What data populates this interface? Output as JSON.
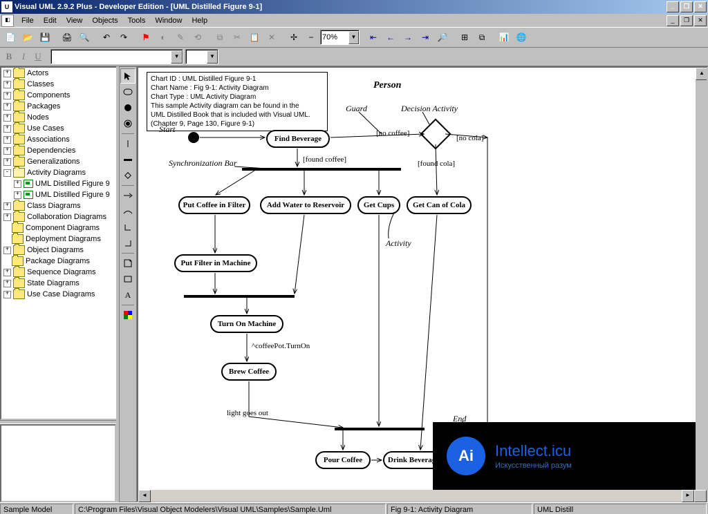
{
  "title": "Visual UML 2.9.2 Plus - Developer Edition - [UML Distilled Figure 9-1]",
  "menus": [
    "File",
    "Edit",
    "View",
    "Objects",
    "Tools",
    "Window",
    "Help"
  ],
  "zoom": "70%",
  "tree": {
    "root": [
      {
        "pm": "+",
        "label": "Actors"
      },
      {
        "pm": "+",
        "label": "Classes"
      },
      {
        "pm": "+",
        "label": "Components"
      },
      {
        "pm": "+",
        "label": "Packages"
      },
      {
        "pm": "+",
        "label": "Nodes"
      },
      {
        "pm": "+",
        "label": "Use Cases"
      },
      {
        "pm": "+",
        "label": "Associations"
      },
      {
        "pm": "+",
        "label": "Dependencies"
      },
      {
        "pm": "+",
        "label": "Generalizations"
      },
      {
        "pm": "-",
        "label": "Activity Diagrams",
        "open": true,
        "children": [
          {
            "label": "UML Distilled Figure 9"
          },
          {
            "label": "UML Distilled Figure 9"
          }
        ]
      },
      {
        "pm": "+",
        "label": "Class Diagrams"
      },
      {
        "pm": "+",
        "label": "Collaboration Diagrams"
      },
      {
        "pm": " ",
        "label": "Component Diagrams"
      },
      {
        "pm": " ",
        "label": "Deployment Diagrams"
      },
      {
        "pm": "+",
        "label": "Object Diagrams"
      },
      {
        "pm": " ",
        "label": "Package Diagrams"
      },
      {
        "pm": "+",
        "label": "Sequence Diagrams"
      },
      {
        "pm": "+",
        "label": "State Diagrams"
      },
      {
        "pm": "+",
        "label": "Use Case Diagrams"
      }
    ]
  },
  "note": {
    "l1": "Chart ID : UML Distilled Figure 9-1",
    "l2": "Chart Name : Fig 9-1: Activity Diagram",
    "l3": "Chart Type : UML Activity Diagram",
    "l4": "This sample Activity diagram can be found in the",
    "l5": "UML Distilled Book that is included with Visual UML.",
    "l6": "(Chapter 9, Page 130, Figure 9-1)"
  },
  "swimlane": "Person",
  "labels": {
    "start": "Start",
    "guard": "Guard",
    "decision": "Decision Activity",
    "syncbar": "Synchronization Bar",
    "activity": "Activity",
    "end": "End"
  },
  "guards": {
    "nocoffee": "[no coffee]",
    "foundcoffee": "[found coffee]",
    "nocola": "[no cola]",
    "foundcola": "[found cola]",
    "turnon": "^coffeePot.TurnOn",
    "light": "light goes out"
  },
  "acts": {
    "find": "Find Beverage",
    "pcf": "Put Coffee in Filter",
    "awr": "Add Water to Reservoir",
    "gc": "Get Cups",
    "gcc": "Get Can of Cola",
    "pfm": "Put Filter in Machine",
    "tom": "Turn On Machine",
    "brew": "Brew Coffee",
    "pour": "Pour Coffee",
    "drink": "Drink Beverage"
  },
  "status": {
    "model": "Sample Model",
    "path": "C:\\Program Files\\Visual Object Modelers\\Visual UML\\Samples\\Sample.Uml",
    "diag": "Fig 9-1: Activity Diagram",
    "extra": "UML Distill"
  },
  "watermark": {
    "brand": "Intellect.icu",
    "tag": "Искусственный разум",
    "logo": "Ai"
  }
}
